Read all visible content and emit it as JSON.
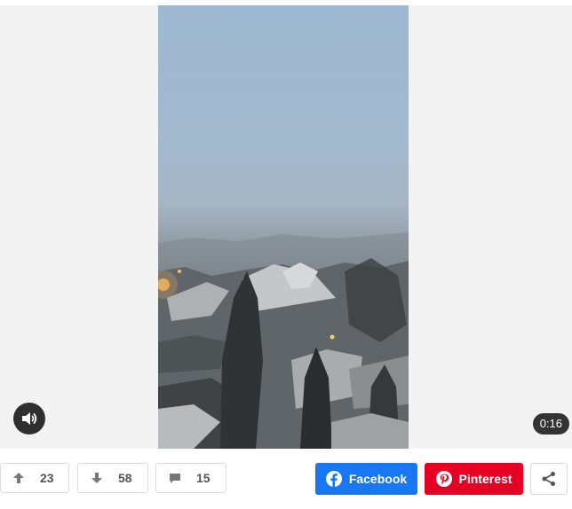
{
  "video": {
    "duration": "0:16",
    "sound_icon": "speaker-icon"
  },
  "actions": {
    "upvotes": "23",
    "downvotes": "58",
    "comments": "15",
    "upvote_icon": "arrow-up-icon",
    "downvote_icon": "arrow-down-icon",
    "comment_icon": "comment-icon"
  },
  "share": {
    "facebook_label": "Facebook",
    "pinterest_label": "Pinterest",
    "facebook_color": "#1877f2",
    "pinterest_color": "#e60023",
    "more_icon": "share-icon"
  }
}
